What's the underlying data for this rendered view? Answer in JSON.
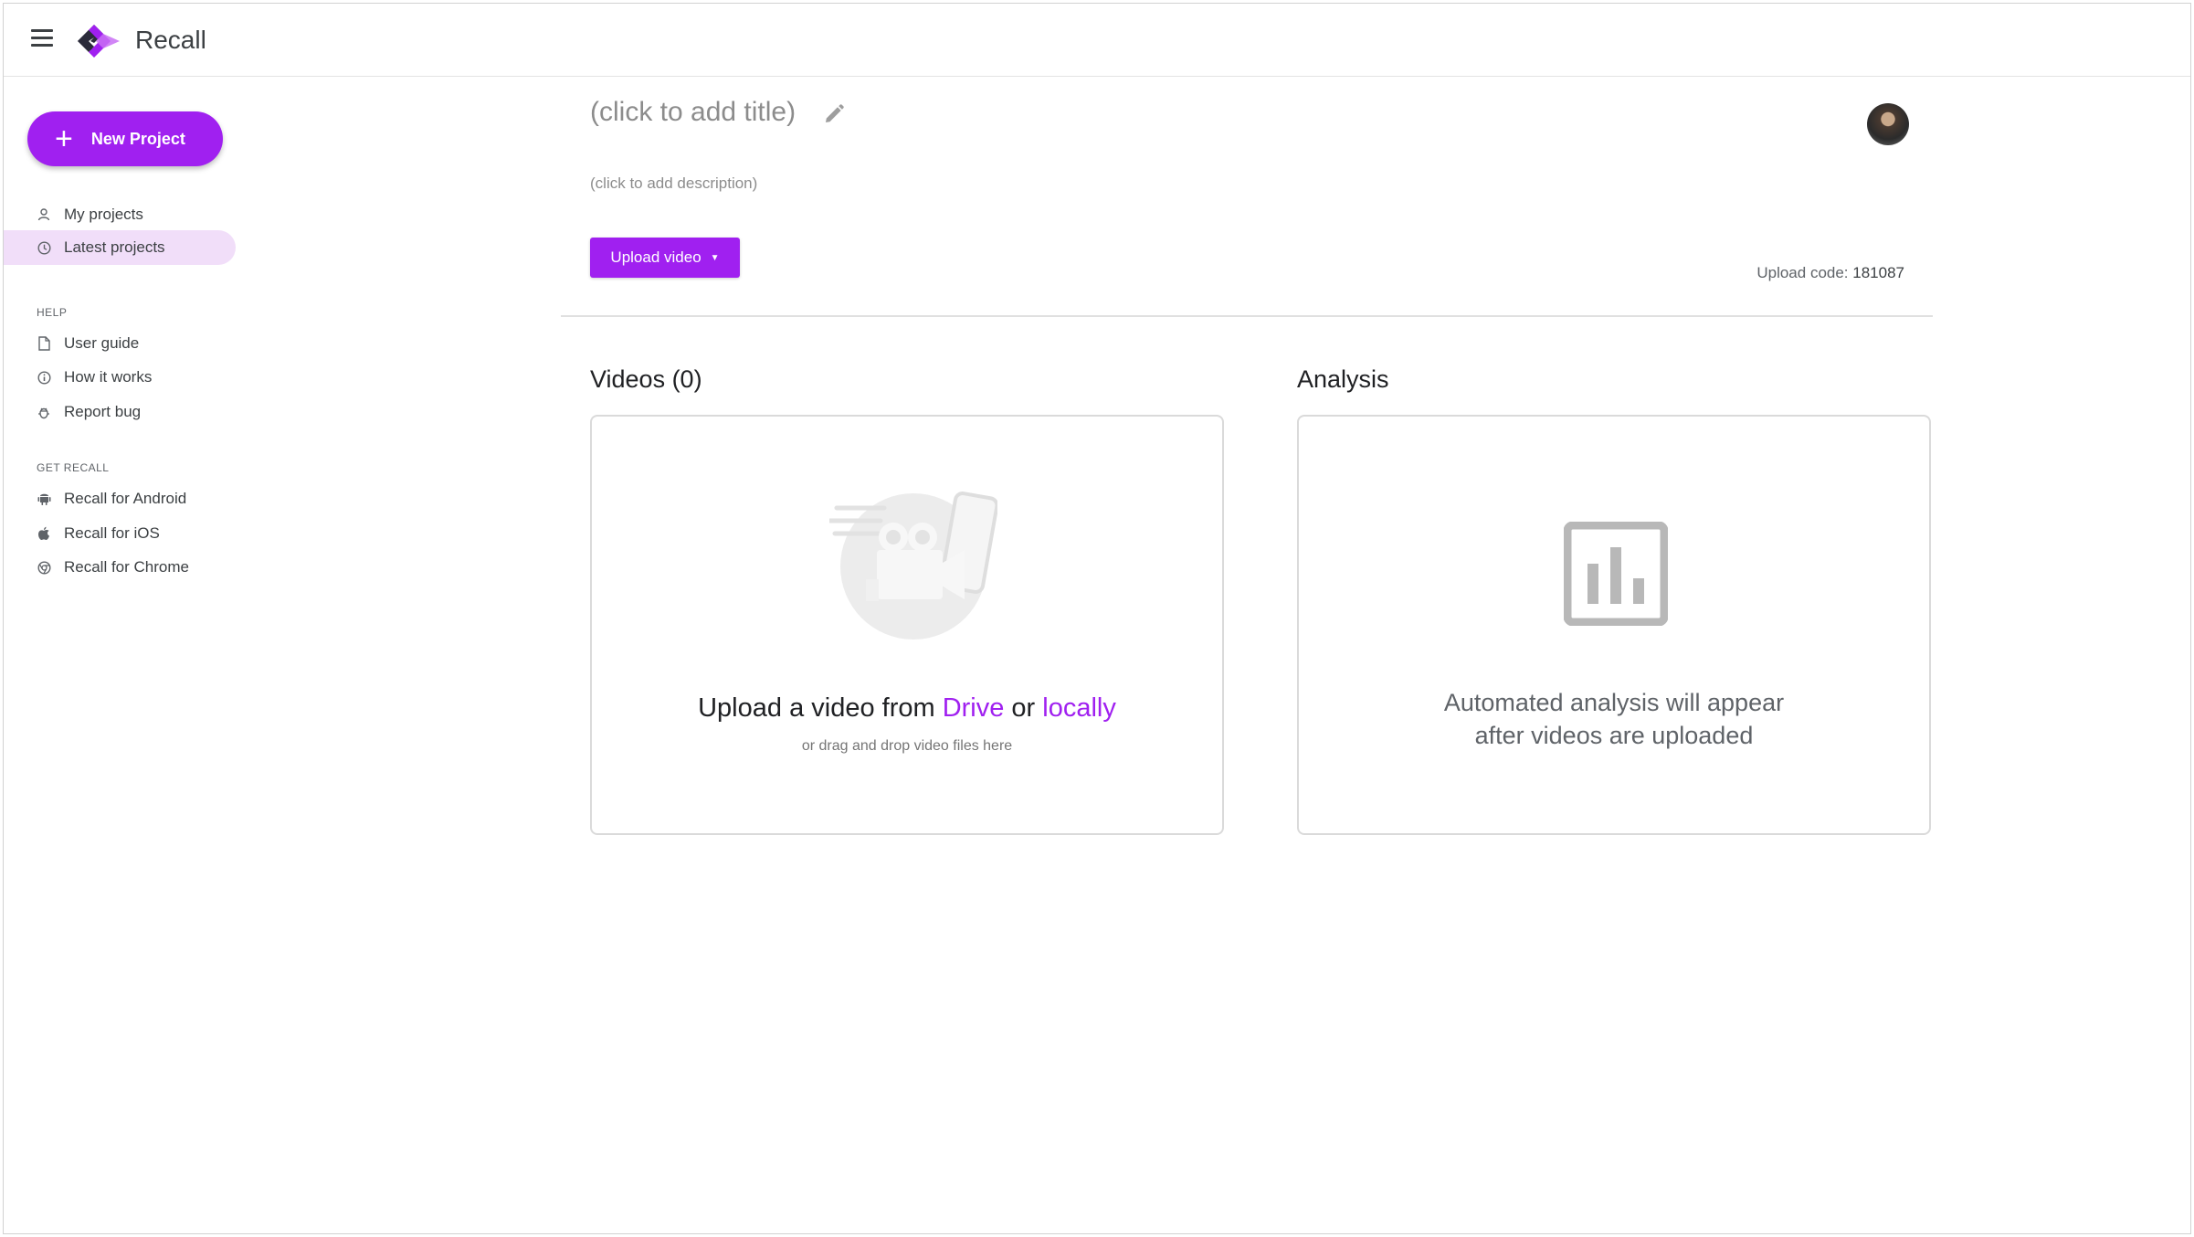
{
  "app": {
    "title": "Recall"
  },
  "sidebar": {
    "new_project_label": "New Project",
    "nav": [
      {
        "label": "My projects",
        "icon": "person-icon"
      },
      {
        "label": "Latest projects",
        "icon": "clock-icon",
        "active": true
      }
    ],
    "help_label": "HELP",
    "help": [
      {
        "label": "User guide",
        "icon": "document-icon"
      },
      {
        "label": "How it works",
        "icon": "info-icon"
      },
      {
        "label": "Report bug",
        "icon": "bug-icon"
      }
    ],
    "get_label": "GET RECALL",
    "get": [
      {
        "label": "Recall for Android",
        "icon": "android-icon"
      },
      {
        "label": "Recall for iOS",
        "icon": "apple-icon"
      },
      {
        "label": "Recall for Chrome",
        "icon": "chrome-icon"
      }
    ]
  },
  "project": {
    "title_placeholder": "(click to add title)",
    "description_placeholder": "(click to add description)",
    "upload_button_label": "Upload video",
    "upload_code_label": "Upload code:",
    "upload_code": "181087"
  },
  "videos": {
    "heading": "Videos (0)",
    "upload_prefix": "Upload a video from ",
    "drive_link": "Drive",
    "or_text": " or ",
    "local_link": "locally",
    "drag_hint": "or drag and drop video files here"
  },
  "analysis": {
    "heading": "Analysis",
    "empty_line1": "Automated analysis will appear",
    "empty_line2": "after videos are uploaded"
  },
  "colors": {
    "accent": "#a020f0",
    "active_nav_bg": "#f1def9"
  }
}
